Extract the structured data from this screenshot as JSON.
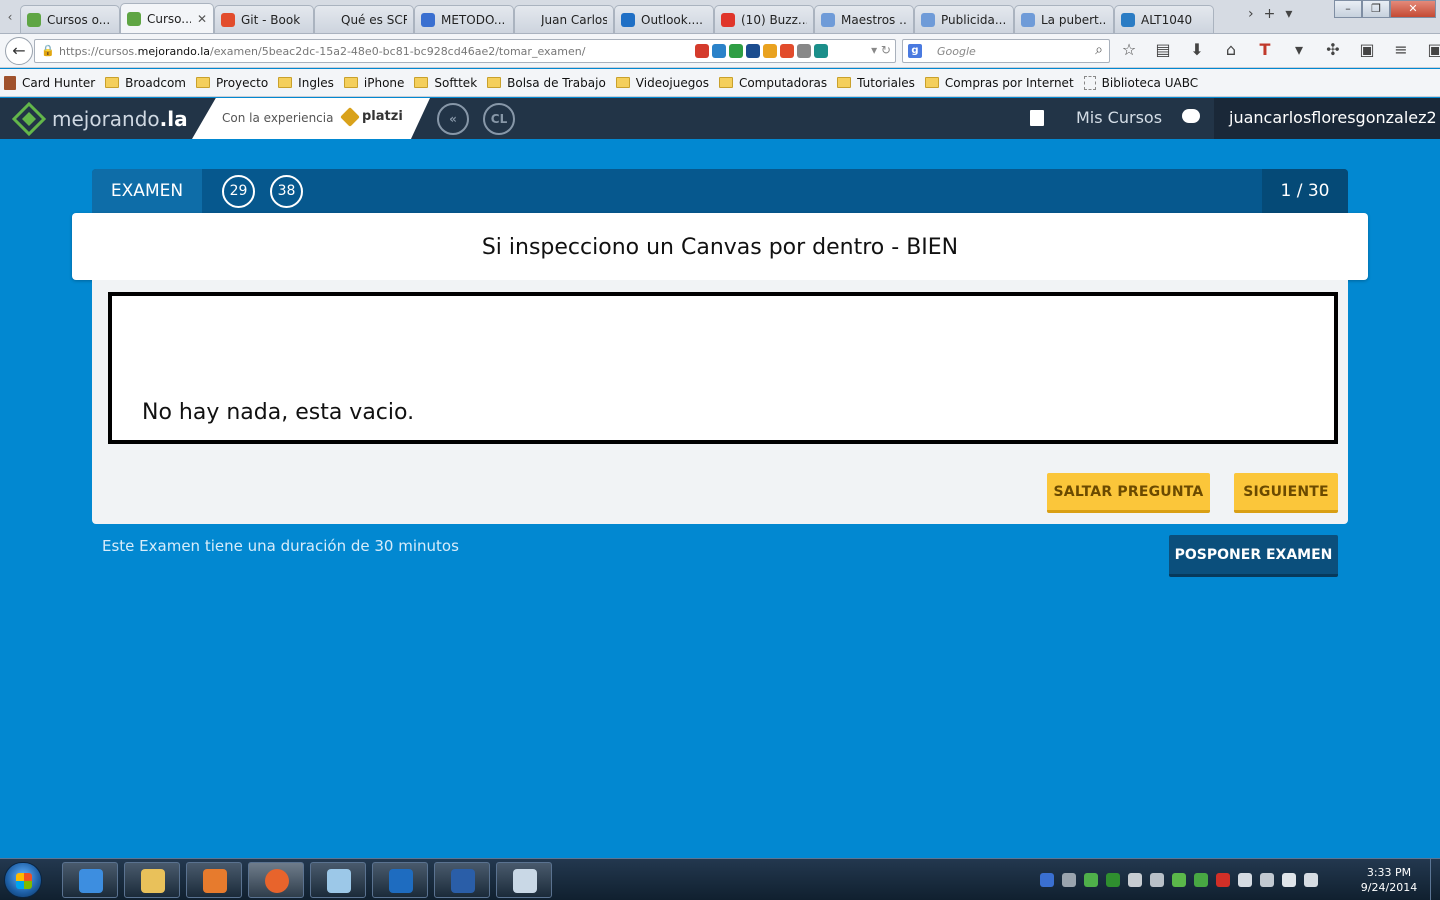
{
  "browser": {
    "tabs": [
      {
        "label": "Cursos o...",
        "icon": "mejorando-icon",
        "color": "#5fa544"
      },
      {
        "label": "Curso...",
        "icon": "mejorando-icon",
        "color": "#5fa544",
        "active": true
      },
      {
        "label": "Git - Book",
        "icon": "git-icon",
        "color": "#e24c2c"
      },
      {
        "label": "Qué es SCRU...",
        "icon": "blank-icon",
        "color": ""
      },
      {
        "label": "METODO...",
        "icon": "globe-icon",
        "color": "#3a6fd0"
      },
      {
        "label": "Juan Carlos Fl...",
        "icon": "blank-icon",
        "color": ""
      },
      {
        "label": "Outlook....",
        "icon": "outlook-icon",
        "color": "#1f6fc5"
      },
      {
        "label": "(10) Buzz...",
        "icon": "buzzfeed-icon",
        "color": "#e0352a"
      },
      {
        "label": "Maestros ...",
        "icon": "mh-icon",
        "color": "#6f9bd8"
      },
      {
        "label": "Publicida...",
        "icon": "mh-icon",
        "color": "#6f9bd8"
      },
      {
        "label": "La pubert...",
        "icon": "mh-icon",
        "color": "#6f9bd8"
      },
      {
        "label": "ALT1040",
        "icon": "alt1040-icon",
        "color": "#2b7cc4"
      }
    ],
    "url_prefix": "https://cursos.",
    "url_host": "mejorando.la",
    "url_path": "/examen/5beac2dc-15a2-48e0-bc81-bc928cd46ae2/tomar_examen/",
    "search_placeholder": "Google",
    "search_engine_icon": "g",
    "bookmarks": [
      {
        "label": "Card Hunter",
        "icon": "book-icon"
      },
      {
        "label": "Broadcom",
        "icon": "folder-icon"
      },
      {
        "label": "Proyecto",
        "icon": "folder-icon"
      },
      {
        "label": "Ingles",
        "icon": "folder-icon"
      },
      {
        "label": "iPhone",
        "icon": "folder-icon"
      },
      {
        "label": "Softtek",
        "icon": "folder-icon"
      },
      {
        "label": "Bolsa de Trabajo",
        "icon": "folder-icon"
      },
      {
        "label": "Videojuegos",
        "icon": "folder-icon"
      },
      {
        "label": "Computadoras",
        "icon": "folder-icon"
      },
      {
        "label": "Tutoriales",
        "icon": "folder-icon"
      },
      {
        "label": "Compras por Internet",
        "icon": "folder-icon"
      },
      {
        "label": "Biblioteca UABC",
        "icon": "blank-page-icon"
      }
    ]
  },
  "site": {
    "logo_main": "mejorando",
    "logo_suffix": ".la",
    "partner_label": "Con la experiencia",
    "partner_name": "platzi",
    "circle_buttons": [
      "«",
      "CL"
    ],
    "nav_courses": "Mis Cursos",
    "username": "juancarlosfloresgonzalez2"
  },
  "exam": {
    "label": "EXAMEN",
    "counters": [
      "29",
      "38"
    ],
    "page_indicator": "1 / 30",
    "question": "Si inspecciono un Canvas por dentro - BIEN",
    "answer": "No hay nada, esta vacio.",
    "skip_button": "SALTAR PREGUNTA",
    "next_button": "SIGUIENTE",
    "duration_text": "Este Examen tiene una duración de 30 minutos",
    "postpone_button": "POSPONER EXAMEN"
  },
  "taskbar": {
    "apps": [
      {
        "name": "internet-explorer-icon",
        "color": "#3d8ee0"
      },
      {
        "name": "file-explorer-icon",
        "color": "#e9c15a"
      },
      {
        "name": "media-player-icon",
        "color": "#e77b2d"
      },
      {
        "name": "firefox-icon",
        "color": "#e8642c"
      },
      {
        "name": "notepad-icon",
        "color": "#9cc8e8"
      },
      {
        "name": "lync-icon",
        "color": "#1e6cc0"
      },
      {
        "name": "remote-desktop-icon",
        "color": "#2a5ea8"
      },
      {
        "name": "paint-icon",
        "color": "#c9d8e6"
      }
    ],
    "time": "3:33 PM",
    "date": "9/24/2014"
  },
  "colors": {
    "page_background": "#0288d1",
    "header_background": "#223447",
    "accent_yellow": "#fbc63a",
    "exam_bar": "#06588e"
  }
}
